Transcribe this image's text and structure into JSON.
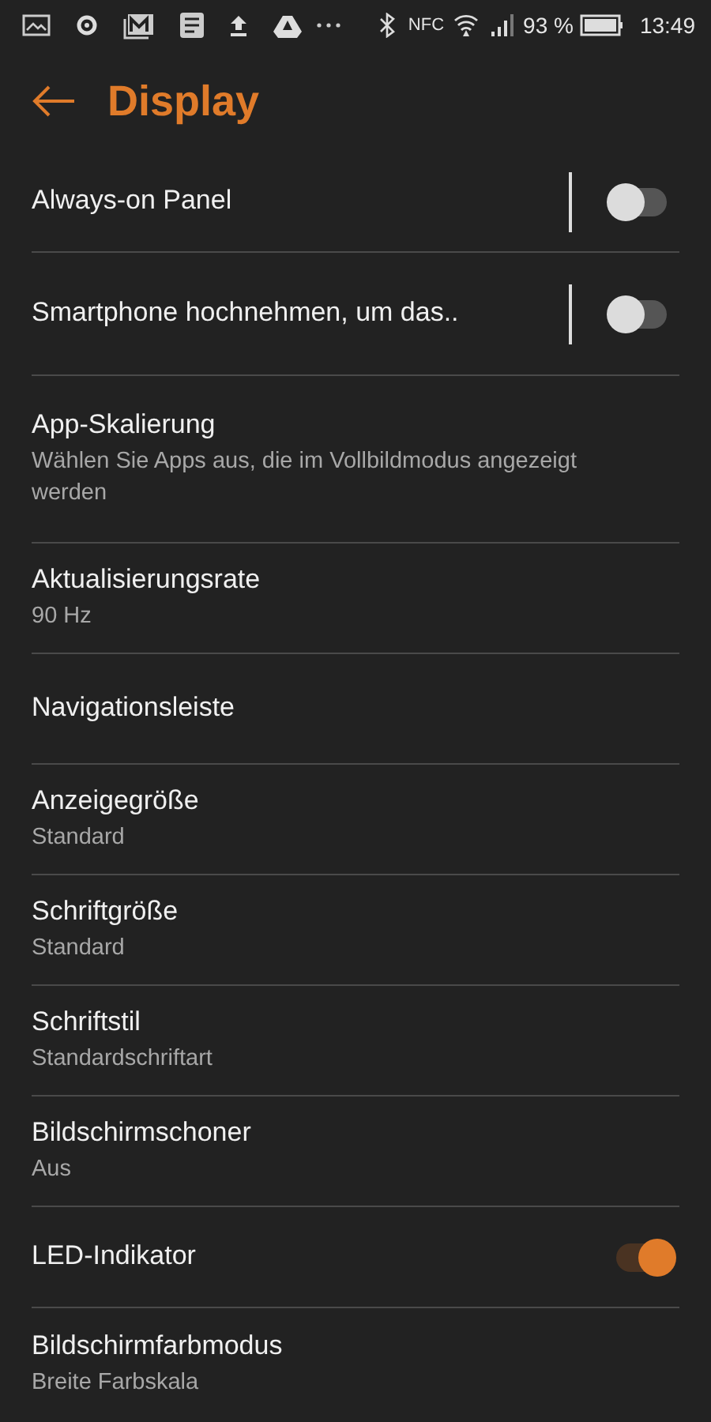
{
  "status_bar": {
    "nfc": "NFC",
    "battery": "93 %",
    "time": "13:49"
  },
  "header": {
    "title": "Display"
  },
  "items": [
    {
      "kind": "toggle_split",
      "title": "Always-on Panel",
      "on": false
    },
    {
      "kind": "toggle_split",
      "title": "Smartphone hochnehmen, um das..",
      "on": false
    },
    {
      "kind": "text",
      "title": "App-Skalierung",
      "subtitle": "Wählen Sie Apps aus, die im Vollbildmodus angezeigt werden"
    },
    {
      "kind": "text",
      "title": "Aktualisierungsrate",
      "subtitle": "90 Hz"
    },
    {
      "kind": "text",
      "title": "Navigationsleiste"
    },
    {
      "kind": "text",
      "title": "Anzeigegröße",
      "subtitle": "Standard"
    },
    {
      "kind": "text",
      "title": "Schriftgröße",
      "subtitle": "Standard"
    },
    {
      "kind": "text",
      "title": "Schriftstil",
      "subtitle": "Standardschriftart"
    },
    {
      "kind": "text",
      "title": "Bildschirmschoner",
      "subtitle": "Aus"
    },
    {
      "kind": "toggle",
      "title": "LED-Indikator",
      "on": true
    },
    {
      "kind": "text",
      "title": "Bildschirmfarbmodus",
      "subtitle": "Breite Farbskala"
    }
  ]
}
